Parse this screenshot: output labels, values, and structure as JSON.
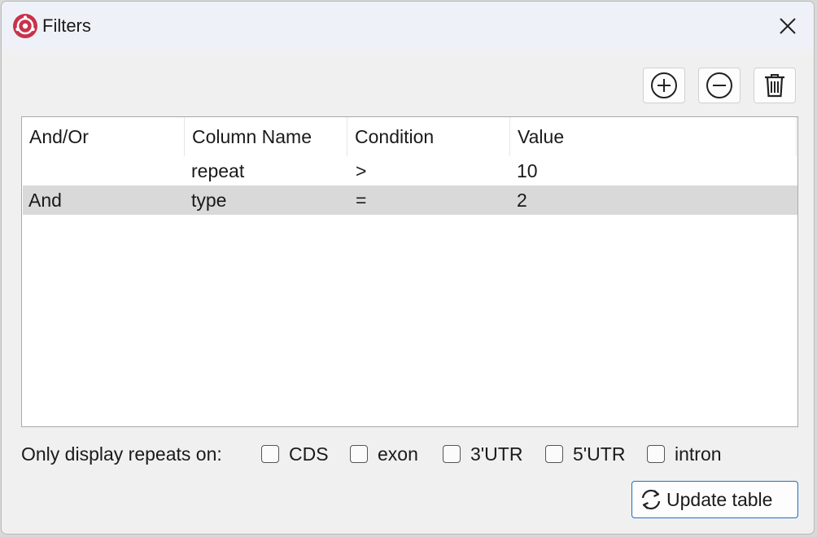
{
  "window": {
    "title": "Filters"
  },
  "toolbar": {
    "add_icon": "plus-circle-icon",
    "remove_icon": "minus-circle-icon",
    "delete_icon": "trash-icon"
  },
  "table": {
    "columns": [
      "And/Or",
      "Column Name",
      "Condition",
      "Value"
    ],
    "rows": [
      {
        "andor": "",
        "column": "repeat",
        "condition": ">",
        "value": "10",
        "selected": false
      },
      {
        "andor": "And",
        "column": "type",
        "condition": "=",
        "value": "2",
        "selected": true
      }
    ]
  },
  "region_filter": {
    "label": "Only display repeats on:",
    "options": [
      {
        "label": "CDS",
        "checked": false
      },
      {
        "label": "exon",
        "checked": false
      },
      {
        "label": "3'UTR",
        "checked": false
      },
      {
        "label": "5'UTR",
        "checked": false
      },
      {
        "label": "intron",
        "checked": false
      }
    ]
  },
  "update_button": {
    "label": "Update table",
    "icon": "refresh-icon"
  },
  "colors": {
    "accent": "#1e6fc4",
    "app_icon": "#c8334a",
    "selected_row": "#d9d9d9"
  }
}
